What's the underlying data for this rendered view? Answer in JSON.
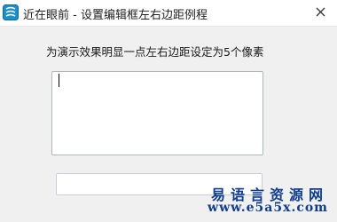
{
  "window": {
    "title": "近在眼前 - 设置编辑框左右边距例程",
    "app_icon": "app-logo-icon",
    "close_icon": "close-icon"
  },
  "main": {
    "label": "为演示效果明显一点左右边距设定为5个像素",
    "textarea": {
      "value": ""
    },
    "input": {
      "value": ""
    }
  },
  "watermark": {
    "line1": "易语言资源网",
    "line2": "www.e5a5x.com"
  },
  "colors": {
    "accent": "#1a8fc9",
    "watermark": "#0f3d8c"
  }
}
